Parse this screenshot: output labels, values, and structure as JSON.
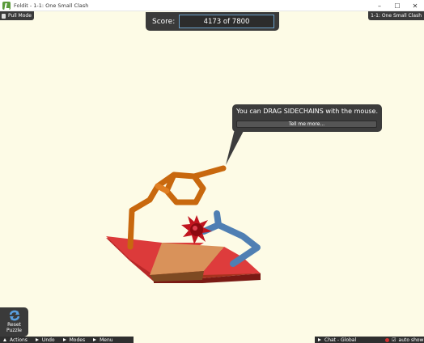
{
  "window": {
    "title": "Foldit - 1-1: One Small Clash",
    "minimize": "–",
    "maximize": "☐",
    "close": "✕"
  },
  "pull_mode": {
    "label": "Pull Mode"
  },
  "level_name": "1-1: One Small Clash",
  "score": {
    "label": "Score:",
    "value": "4173 of 7800"
  },
  "tooltip": {
    "text": "You can DRAG SIDECHAINS with the mouse.",
    "button": "Tell me more..."
  },
  "reset": {
    "label_line1": "Reset",
    "label_line2": "Puzzle"
  },
  "bottom_menu": [
    {
      "label": "Actions",
      "arrow": "up"
    },
    {
      "label": "Undo",
      "arrow": "right"
    },
    {
      "label": "Modes",
      "arrow": "right"
    },
    {
      "label": "Menu",
      "arrow": "right"
    }
  ],
  "chat": {
    "label": "Chat - Global",
    "auto_show": "auto show"
  },
  "colors": {
    "background": "#fdfbe6",
    "panel": "#3a3a3a",
    "sidechain_orange": "#c8680e",
    "sidechain_blue": "#4f7fb3",
    "sheet_red": "#dc3a3a",
    "sheet_tan": "#d9925a",
    "clash_red": "#c0141e"
  }
}
